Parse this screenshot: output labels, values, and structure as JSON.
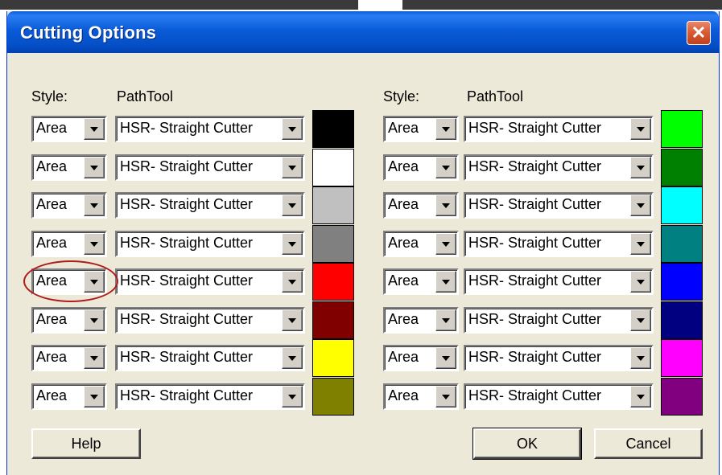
{
  "window": {
    "title": "Cutting Options",
    "close_glyph": "✕"
  },
  "left_panel": {
    "style_header": "Style:",
    "pathtool_header": "PathTool",
    "rows": [
      {
        "style": "Area",
        "pathtool": "HSR- Straight Cutter",
        "color": "#000000"
      },
      {
        "style": "Area",
        "pathtool": "HSR- Straight Cutter",
        "color": "#ffffff"
      },
      {
        "style": "Area",
        "pathtool": "HSR- Straight Cutter",
        "color": "#c0c0c0"
      },
      {
        "style": "Area",
        "pathtool": "HSR- Straight Cutter",
        "color": "#808080"
      },
      {
        "style": "Area",
        "pathtool": "HSR- Straight Cutter",
        "color": "#ff0000"
      },
      {
        "style": "Area",
        "pathtool": "HSR- Straight Cutter",
        "color": "#800000"
      },
      {
        "style": "Area",
        "pathtool": "HSR- Straight Cutter",
        "color": "#ffff00"
      },
      {
        "style": "Area",
        "pathtool": "HSR- Straight Cutter",
        "color": "#808000"
      }
    ]
  },
  "right_panel": {
    "style_header": "Style:",
    "pathtool_header": "PathTool",
    "rows": [
      {
        "style": "Area",
        "pathtool": "HSR- Straight Cutter",
        "color": "#00ff00"
      },
      {
        "style": "Area",
        "pathtool": "HSR- Straight Cutter",
        "color": "#008000"
      },
      {
        "style": "Area",
        "pathtool": "HSR- Straight Cutter",
        "color": "#00ffff"
      },
      {
        "style": "Area",
        "pathtool": "HSR- Straight Cutter",
        "color": "#008080"
      },
      {
        "style": "Area",
        "pathtool": "HSR- Straight Cutter",
        "color": "#0000ff"
      },
      {
        "style": "Area",
        "pathtool": "HSR- Straight Cutter",
        "color": "#000080"
      },
      {
        "style": "Area",
        "pathtool": "HSR- Straight Cutter",
        "color": "#ff00ff"
      },
      {
        "style": "Area",
        "pathtool": "HSR- Straight Cutter",
        "color": "#800080"
      }
    ]
  },
  "buttons": {
    "help": "Help",
    "ok": "OK",
    "cancel": "Cancel"
  },
  "icons": {
    "dropdown": "chevron-down-icon",
    "close": "close-icon"
  },
  "highlighted_control": "left_panel.rows.4.style"
}
